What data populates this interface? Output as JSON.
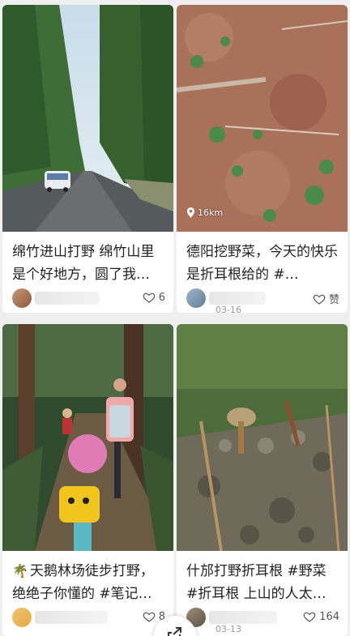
{
  "feed": {
    "cards": [
      {
        "title": "绵竹进山打野 绵竹山里是个好地方，圆了我…",
        "likes": "6",
        "location": "",
        "date": ""
      },
      {
        "title": "德阳挖野菜，今天的快乐是折耳根给的 #…",
        "likes": "赞",
        "location": "16km",
        "date": "03-16"
      },
      {
        "title_prefix_icon": "palm-tree-icon",
        "title": "天鹅林场徒步打野，绝绝子你懂的 #笔记…",
        "likes": "8",
        "location": "",
        "date": ""
      },
      {
        "title": "什邡打野折耳根 #野菜 #折耳根 上山的人太…",
        "likes": "164",
        "location": "",
        "date": "03-13"
      }
    ]
  },
  "icons": {
    "like": "heart-outline-icon",
    "location": "location-pin-icon",
    "share": "share-icon"
  },
  "colors": {
    "background": "#efefef",
    "card": "#ffffff",
    "text": "#222222",
    "muted": "#999999"
  }
}
